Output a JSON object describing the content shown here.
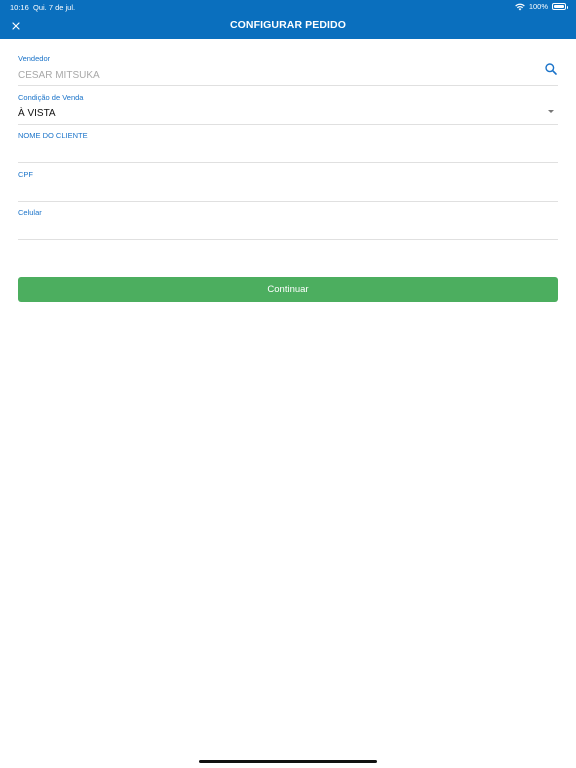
{
  "status_bar": {
    "time": "10:16",
    "date": "Qui. 7 de jul.",
    "battery": "100%"
  },
  "header": {
    "title": "CONFIGURAR PEDIDO",
    "close_icon": "close-icon",
    "background_color": "#0a6fbe"
  },
  "form": {
    "vendedor": {
      "label": "Vendedor",
      "placeholder": "CESAR MITSUKA",
      "icon": "search-icon"
    },
    "condicao": {
      "label": "Condição de Venda",
      "value": "À VISTA",
      "icon": "chevron-down-icon"
    },
    "nome_cliente": {
      "label": "NOME DO CLIENTE",
      "value": ""
    },
    "cpf": {
      "label": "CPF",
      "value": ""
    },
    "celular": {
      "label": "Celular",
      "value": ""
    }
  },
  "continue_button": {
    "label": "Continuar",
    "color": "#4cae5f"
  }
}
